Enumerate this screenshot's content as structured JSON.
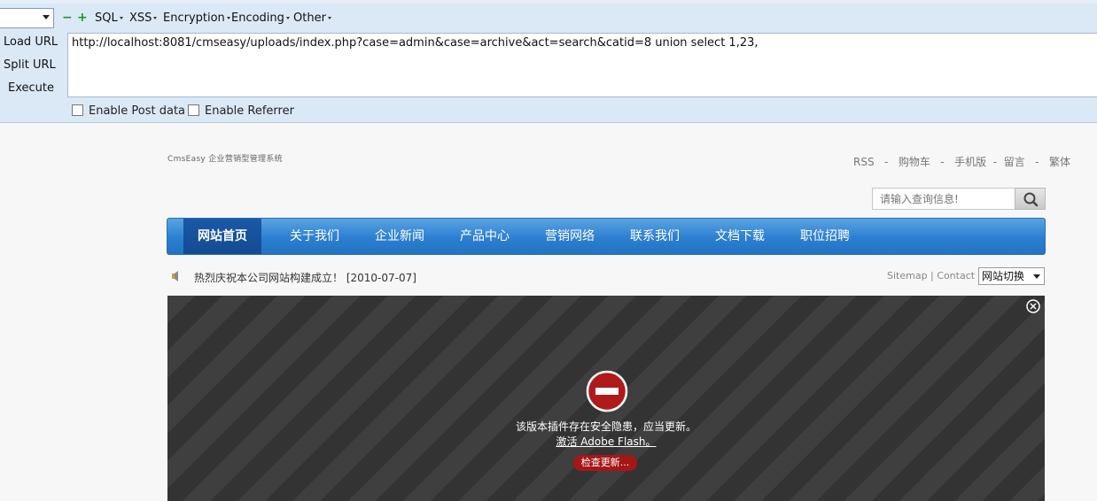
{
  "hackbar": {
    "menus": [
      "SQL",
      "XSS",
      "Encryption",
      "Encoding",
      "Other"
    ],
    "buttons": {
      "load": "Load URL",
      "split": "Split URL",
      "execute": "Execute"
    },
    "url": "http://localhost:8081/cmseasy/uploads/index.php?case=admin&case=archive&act=search&catid=8 union select 1,23,",
    "enable_post": "Enable Post data",
    "enable_referrer": "Enable Referrer"
  },
  "site": {
    "logo_text": "CmsEasy 企业营销型管理系统",
    "top_links": [
      "RSS",
      "购物车",
      "手机版",
      "留言",
      "繁体"
    ],
    "search_placeholder": "请输入查询信息!",
    "nav": [
      "网站首页",
      "关于我们",
      "企业新闻",
      "产品中心",
      "营销网络",
      "联系我们",
      "文档下载",
      "职位招聘"
    ],
    "notice": "热烈庆祝本公司网站构建成立！ [2010-07-07]",
    "sitemap": "Sitemap | Contact",
    "switch_label": "网站切换"
  },
  "flash": {
    "message": "该版本插件存在安全隐患，应当更新。",
    "activate": "激活 Adobe Flash。",
    "check_update": "检查更新..."
  },
  "colors": {
    "toolbar_bg": "#dbe9f7",
    "nav_blue": "#2c7fd0",
    "nav_active": "#144b92",
    "flash_btn": "#a71616"
  }
}
